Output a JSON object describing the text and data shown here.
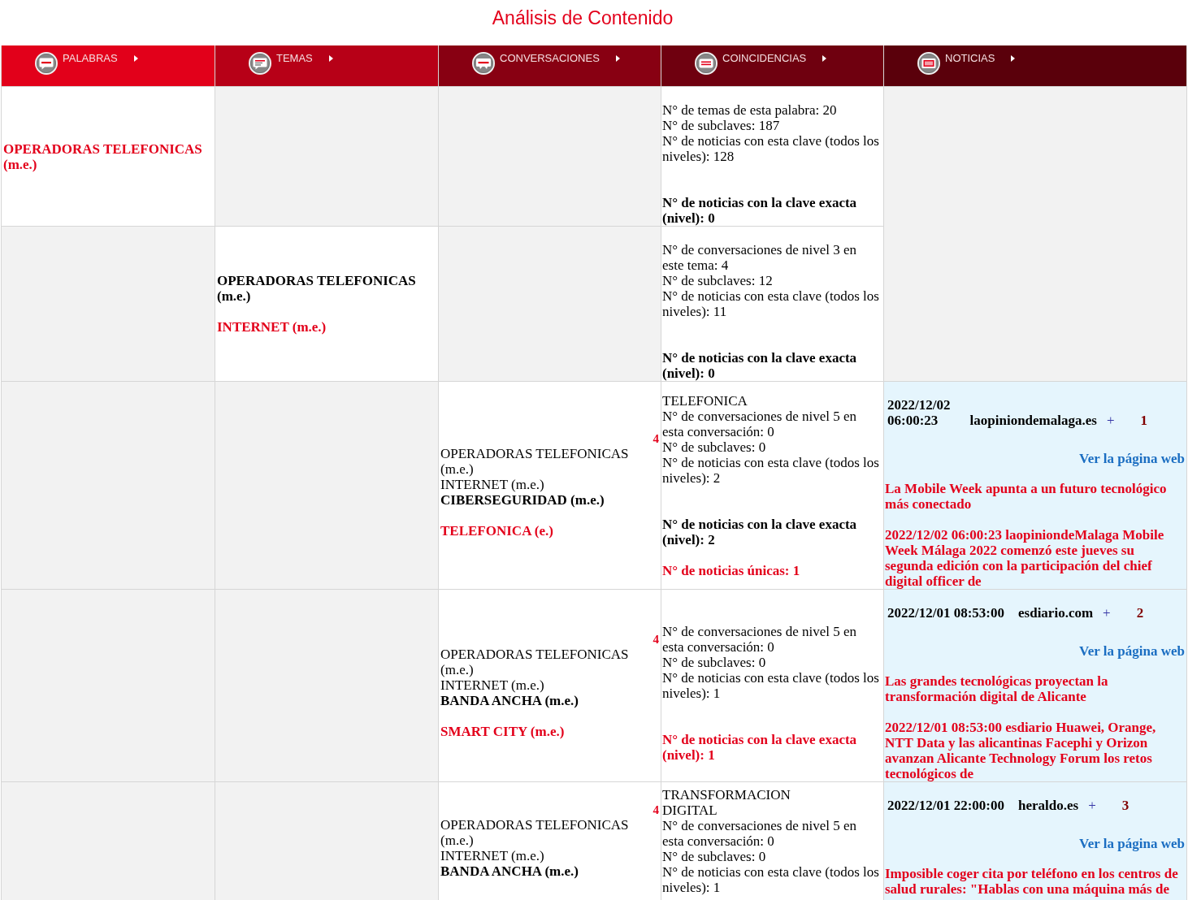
{
  "title": "Análisis de Contenido",
  "columns": [
    {
      "label": "PALABRAS"
    },
    {
      "label": "TEMAS"
    },
    {
      "label": "CONVERSACIONES"
    },
    {
      "label": "COINCIDENCIAS"
    },
    {
      "label": "NOTICIAS"
    }
  ],
  "rows": [
    {
      "cells": [
        {
          "kind": "path",
          "items": [
            {
              "kind": "match",
              "text": "OPERADORAS TELEFONICAS (m.e.)"
            }
          ]
        },
        {
          "kind": "blank"
        },
        {
          "kind": "blank"
        },
        {
          "kind": "stats",
          "lines": [
            "N° de temas de esta palabra: 20",
            "N° de subclaves: 187",
            "N° de noticias con esta clave (todos los niveles): 128"
          ],
          "exact": {
            "text": "N° de noticias con la clave exacta (nivel): 0",
            "highlighted": false
          }
        },
        {
          "kind": "blank",
          "spans_next_row": true
        }
      ]
    },
    {
      "cells": [
        {
          "kind": "blank"
        },
        {
          "kind": "path",
          "items": [
            {
              "kind": "current",
              "text": "OPERADORAS TELEFONICAS (m.e.)"
            },
            {
              "kind": "match",
              "text": "INTERNET (m.e.)"
            }
          ]
        },
        {
          "kind": "blank"
        },
        {
          "kind": "stats",
          "lines": [
            "N° de conversaciones de nivel 3 en este tema: 4",
            "N° de subclaves: 12",
            "N° de noticias con esta clave (todos los niveles): 11"
          ],
          "exact": {
            "text": "N° de noticias con la clave exacta (nivel): 0",
            "highlighted": false
          }
        }
      ]
    },
    {
      "cells": [
        {
          "kind": "blank"
        },
        {
          "kind": "blank"
        },
        {
          "kind": "path",
          "number": "4",
          "items": [
            {
              "kind": "ancestor",
              "text": "OPERADORAS TELEFONICAS (m.e.)"
            },
            {
              "kind": "ancestor",
              "text": "INTERNET (m.e.)"
            },
            {
              "kind": "current",
              "text": "CIBERSEGURIDAD (m.e.)"
            },
            {
              "kind": "match",
              "text": "TELEFONICA (e.)"
            }
          ]
        },
        {
          "kind": "stats",
          "heading": "TELEFONICA",
          "lines": [
            "N° de conversaciones de nivel 5 en esta conversación: 0",
            "N° de subclaves: 0",
            "N° de noticias con esta clave (todos los niveles): 2"
          ],
          "exact": {
            "text": "N° de noticias con la clave exacta (nivel): 2",
            "highlighted": false
          },
          "unique": "N° de noticias únicas: 1"
        },
        {
          "kind": "news",
          "date": "2022/12/02 06:00:23",
          "source": "laopiniondemalaga.es",
          "plus": "+",
          "number": "1",
          "link": "Ver la página web",
          "headline": "La Mobile Week apunta a un futuro tecnológico más conectado",
          "summary": "2022/12/02 06:00:23 laopiniondeMalaga Mobile Week Málaga 2022 comenzó este jueves su segunda edición con la participación del chief digital officer de"
        }
      ]
    },
    {
      "cells": [
        {
          "kind": "blank"
        },
        {
          "kind": "blank"
        },
        {
          "kind": "path",
          "number": "4",
          "items": [
            {
              "kind": "ancestor",
              "text": "OPERADORAS TELEFONICAS (m.e.)"
            },
            {
              "kind": "ancestor",
              "text": "INTERNET (m.e.)"
            },
            {
              "kind": "current",
              "text": "BANDA ANCHA (m.e.)"
            },
            {
              "kind": "match",
              "text": "SMART CITY (m.e.)"
            }
          ]
        },
        {
          "kind": "stats",
          "lines": [
            "N° de conversaciones de nivel 5 en esta conversación: 0",
            "N° de subclaves: 0",
            "N° de noticias con esta clave (todos los niveles): 1"
          ],
          "exact": {
            "text": "N° de noticias con la clave exacta (nivel): 1",
            "highlighted": true
          }
        },
        {
          "kind": "news",
          "date": "2022/12/01 08:53:00",
          "source": "esdiario.com",
          "plus": "+",
          "number": "2",
          "link": "Ver la página web",
          "headline": "Las grandes tecnológicas proyectan la transformación digital de Alicante",
          "summary": "2022/12/01 08:53:00 esdiario Huawei, Orange, NTT Data y las alicantinas Facephi y Orizon avanzan Alicante Technology Forum los retos tecnológicos de"
        }
      ]
    },
    {
      "cells": [
        {
          "kind": "blank"
        },
        {
          "kind": "blank"
        },
        {
          "kind": "path",
          "number": "4",
          "items": [
            {
              "kind": "ancestor",
              "text": "OPERADORAS TELEFONICAS (m.e.)"
            },
            {
              "kind": "ancestor",
              "text": "INTERNET (m.e.)"
            },
            {
              "kind": "current",
              "text": "BANDA ANCHA (m.e.)"
            }
          ]
        },
        {
          "kind": "stats",
          "heading": "TRANSFORMACION DIGITAL",
          "lines": [
            "N° de conversaciones de nivel 5 en esta conversación: 0",
            "N° de subclaves: 0",
            "N° de noticias con esta clave (todos los niveles): 1"
          ]
        },
        {
          "kind": "news",
          "date": "2022/12/01 22:00:00",
          "source": "heraldo.es",
          "plus": "+",
          "number": "3",
          "link": "Ver la página web",
          "headline": "Imposible coger cita por teléfono en los centros de salud rurales: \"Hablas con una máquina más de"
        }
      ]
    }
  ]
}
